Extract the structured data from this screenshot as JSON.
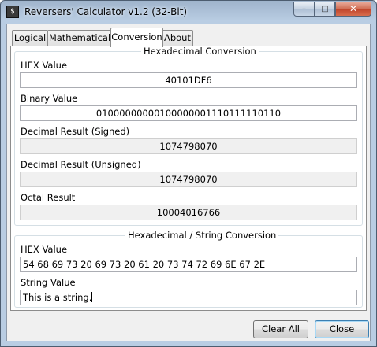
{
  "window": {
    "title": "Reversers' Calculator v1.2 (32-Bit)",
    "icon_glyph": "$",
    "controls": {
      "minimize": "–",
      "maximize": "□",
      "close": "✕"
    }
  },
  "tabs": [
    {
      "label": "Logical",
      "active": false
    },
    {
      "label": "Mathematical",
      "active": false
    },
    {
      "label": "Conversion",
      "active": true
    },
    {
      "label": "About",
      "active": false
    }
  ],
  "hex_conversion": {
    "title": "Hexadecimal Conversion",
    "hex_label": "HEX Value",
    "hex_value": "40101DF6",
    "binary_label": "Binary Value",
    "binary_value": "01000000000100000001110111110110",
    "signed_label": "Decimal Result (Signed)",
    "signed_value": "1074798070",
    "unsigned_label": "Decimal Result (Unsigned)",
    "unsigned_value": "1074798070",
    "octal_label": "Octal Result",
    "octal_value": "10004016766"
  },
  "string_conversion": {
    "title": "Hexadecimal / String Conversion",
    "hex_label": "HEX Value",
    "hex_value": "54 68 69 73 20 69 73 20 61 20 73 74 72 69 6E 67 2E",
    "string_label": "String Value",
    "string_value": "This is a string."
  },
  "buttons": {
    "clear_all": "Clear All",
    "close": "Close"
  }
}
